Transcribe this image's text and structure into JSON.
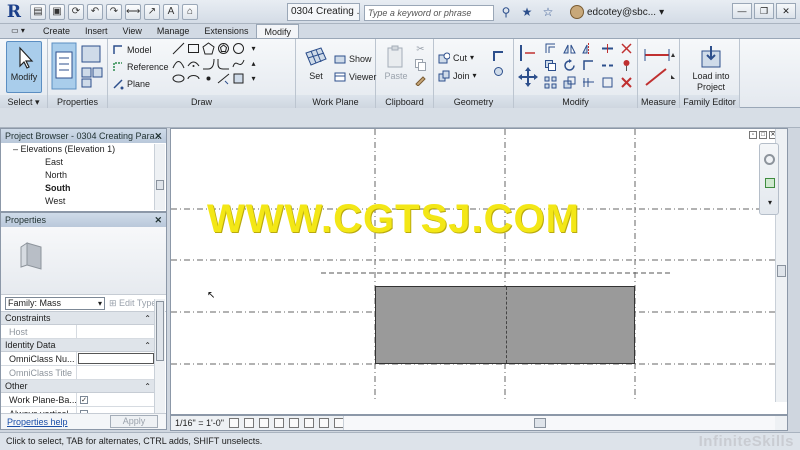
{
  "titlebar": {
    "app_logo": "R",
    "document_title": "0304 Creating ...",
    "search_placeholder": "Type a keyword or phrase",
    "user": "edcotey@sbc...",
    "quick_access": [
      "folder-open-icon",
      "save-icon",
      "sync-icon",
      "undo-icon",
      "redo-icon",
      "measure-icon",
      "dimension-icon",
      "text-icon",
      "3d-view-icon"
    ],
    "window_controls": [
      "—",
      "❐",
      "✕"
    ]
  },
  "tabs": [
    "Create",
    "Insert",
    "View",
    "Manage",
    "Extensions",
    "Modify"
  ],
  "active_tab": "Modify",
  "tab_menu_label": "▭ ▾",
  "ribbon": {
    "select": {
      "label": "Select",
      "modify_label": "Modify"
    },
    "properties": {
      "label": "Properties"
    },
    "draw": {
      "label": "Draw",
      "model_label": "Model",
      "reference_label": "Reference",
      "plane_label": "Plane"
    },
    "work_plane": {
      "label": "Work Plane",
      "set_label": "Set",
      "show_label": "Show",
      "viewer_label": "Viewer"
    },
    "clipboard": {
      "label": "Clipboard",
      "paste_label": "Paste"
    },
    "geometry": {
      "label": "Geometry",
      "cut_label": "Cut",
      "join_label": "Join"
    },
    "modify": {
      "label": "Modify"
    },
    "measure": {
      "label": "Measure"
    },
    "family_editor": {
      "label": "Family Editor",
      "load_label": "Load into Project"
    }
  },
  "project_browser": {
    "title": "Project Browser - 0304 Creating Para...",
    "parent": "Elevations (Elevation 1)",
    "items": [
      "East",
      "North",
      "South",
      "West"
    ],
    "selected": "South"
  },
  "properties": {
    "title": "Properties",
    "family_label": "Family: Mass",
    "edit_type_label": "Edit Type",
    "sections": [
      {
        "name": "Constraints",
        "rows": [
          {
            "key": "Host",
            "value": "",
            "greyed": true
          }
        ]
      },
      {
        "name": "Identity Data",
        "rows": [
          {
            "key": "OmniClass Nu...",
            "value": "",
            "greyed": false
          },
          {
            "key": "OmniClass Title",
            "value": "",
            "greyed": true
          }
        ]
      },
      {
        "name": "Other",
        "rows": [
          {
            "key": "Work Plane-Ba...",
            "checked": true
          },
          {
            "key": "Always vertical",
            "checked": false
          }
        ]
      }
    ],
    "help_label": "Properties help",
    "apply_label": "Apply"
  },
  "canvas": {
    "watermark": "WWW.CGTSJ.COM"
  },
  "view_control": {
    "scale": "1/16\" = 1'-0\""
  },
  "statusbar": {
    "text": "Click to select, TAB for alternates, CTRL adds, SHIFT unselects.",
    "brand": "InfiniteSkills"
  },
  "colors": {
    "accent": "#a9cdeb",
    "watermark": "#f3e716",
    "mass_fill": "#9a9a9a"
  }
}
